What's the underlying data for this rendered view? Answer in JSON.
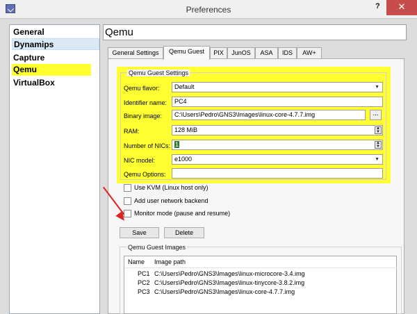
{
  "window": {
    "title": "Preferences",
    "help": "?",
    "close": "✕"
  },
  "sidebar": {
    "items": [
      {
        "label": "General"
      },
      {
        "label": "Dynamips"
      },
      {
        "label": "Capture"
      },
      {
        "label": "Qemu"
      },
      {
        "label": "VirtualBox"
      }
    ]
  },
  "header": {
    "title": "Qemu"
  },
  "tabs": [
    "General Settings",
    "Qemu Guest",
    "PIX",
    "JunOS",
    "ASA",
    "IDS",
    "AW+"
  ],
  "guest_settings": {
    "title": "Qemu Guest Settings",
    "qemu_flavor": {
      "label": "Qemu flavor:",
      "value": "Default"
    },
    "identifier": {
      "label": "Identifier name:",
      "value": "PC4"
    },
    "binary_image": {
      "label": "Binary image:",
      "value": "C:\\Users\\Pedro\\GNS3\\Images\\linux-core-4.7.7.img",
      "browse": "..."
    },
    "ram": {
      "label": "RAM:",
      "value": "128 MiB"
    },
    "nics": {
      "label": "Number of NICs:",
      "value": "1"
    },
    "nic_model": {
      "label": "NIC model:",
      "value": "e1000"
    },
    "options": {
      "label": "Qemu Options:",
      "value": ""
    }
  },
  "checkboxes": [
    {
      "label": "Use KVM (Linux host only)"
    },
    {
      "label": "Add user network backend"
    },
    {
      "label": "Monitor mode (pause and resume)"
    }
  ],
  "buttons": {
    "save": "Save",
    "delete": "Delete"
  },
  "images": {
    "title": "Qemu Guest Images",
    "columns": [
      "Name",
      "Image path"
    ],
    "rows": [
      {
        "name": "PC1",
        "path": "C:\\Users\\Pedro\\GNS3\\Images\\linux-microcore-3.4.img"
      },
      {
        "name": "PC2",
        "path": "C:\\Users\\Pedro\\GNS3\\Images\\linux-tinycore-3.8.2.img"
      },
      {
        "name": "PC3",
        "path": "C:\\Users\\Pedro\\GNS3\\Images\\linux-core-4.7.7.img"
      }
    ]
  },
  "colors": {
    "highlight": "#ffff32",
    "close_button": "#c74d4d",
    "arrow": "#dd2222"
  }
}
